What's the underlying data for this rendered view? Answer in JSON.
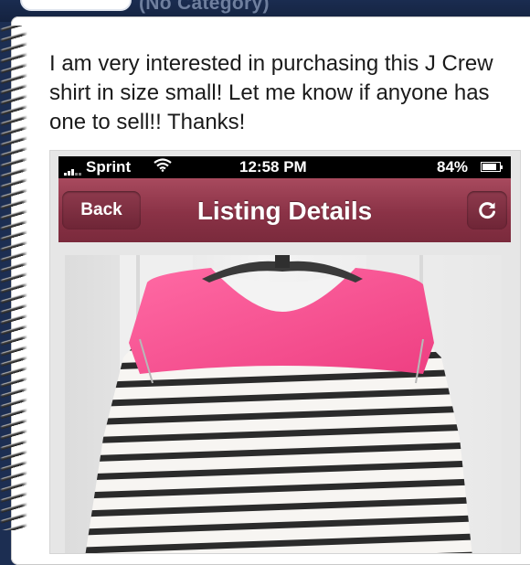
{
  "header": {
    "category_label": "(No Category)"
  },
  "note": {
    "message": "I am very interested in purchasing this J Crew shirt in size small! Let me know if anyone has one to sell!! Thanks!"
  },
  "phone": {
    "status": {
      "carrier": "Sprint",
      "time": "12:58 PM",
      "battery": "84%",
      "battery_level": 0.84
    },
    "nav": {
      "back_label": "Back",
      "title": "Listing Details",
      "refresh_icon": "refresh-icon"
    },
    "photo": {
      "subject": "pink-yoke-striped-shirt"
    }
  },
  "colors": {
    "nav_bar": "#8a3246",
    "app_header": "#1a2c50",
    "shirt_pink": "#f2508c",
    "stripe": "#2b2b2b"
  }
}
